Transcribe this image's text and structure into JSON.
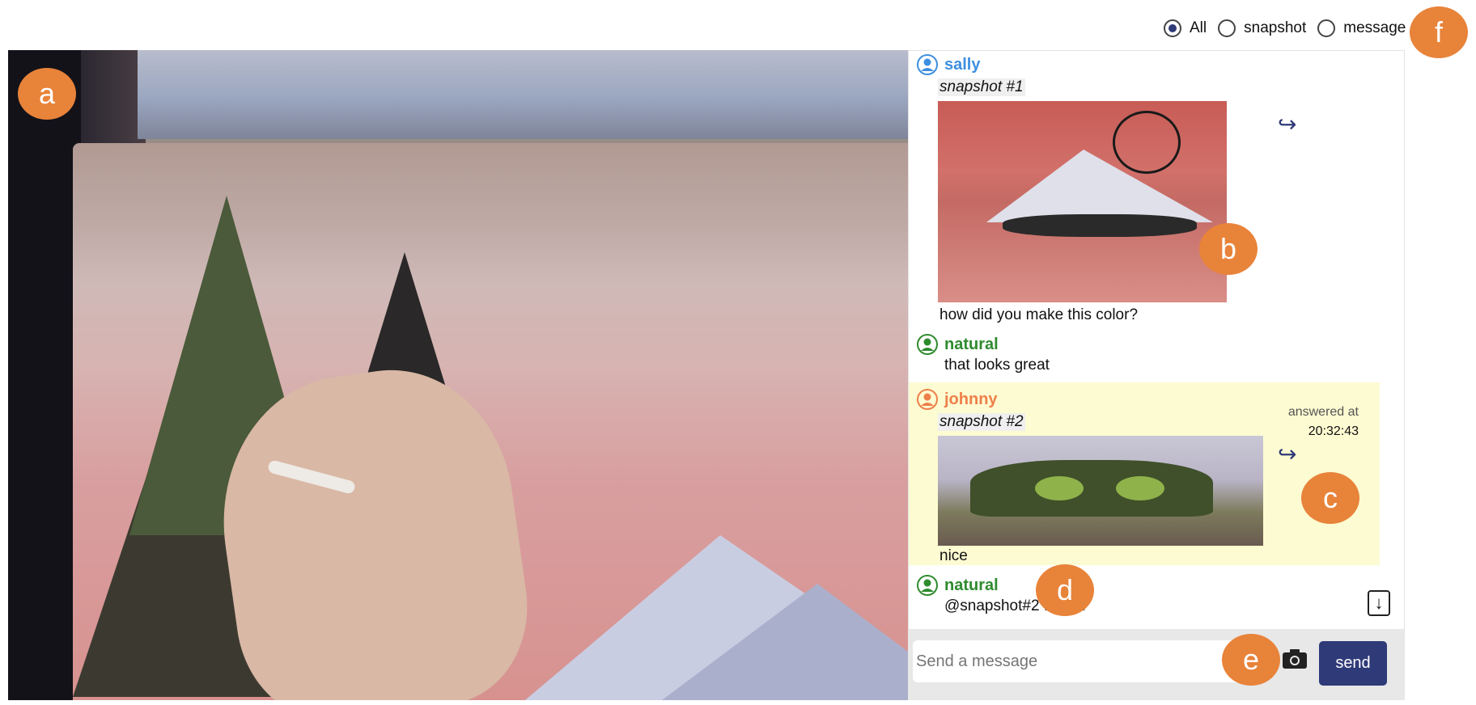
{
  "filters": {
    "options": [
      {
        "label": "All",
        "selected": true
      },
      {
        "label": "snapshot",
        "selected": false
      },
      {
        "label": "message",
        "selected": false
      }
    ]
  },
  "badges": {
    "a": "a",
    "b": "b",
    "c": "c",
    "d": "d",
    "e": "e",
    "f": "f"
  },
  "messages": [
    {
      "user": "sally",
      "user_color": "#3d8fe0",
      "snapshot": "snapshot #1",
      "text": "how did you make this color?"
    },
    {
      "user": "natural",
      "user_color": "#2e8b2e",
      "text": "that looks great"
    },
    {
      "user": "johnny",
      "user_color": "#ef7f4a",
      "snapshot": "snapshot #2",
      "text": "nice",
      "answered_label": "answered at",
      "answered_time": "20:32:43",
      "highlight_color": "#fdfbd1"
    },
    {
      "user": "natural",
      "user_color": "#2e8b2e",
      "text": "@snapshot#2 I did it"
    }
  ],
  "icons": {
    "share": "share-arrow-icon",
    "avatar": "user-avatar-icon",
    "camera": "camera-icon",
    "scroll": "arrow-down-icon"
  },
  "composer": {
    "placeholder": "Send a message",
    "send_label": "send",
    "accent": "#2f3a78"
  }
}
